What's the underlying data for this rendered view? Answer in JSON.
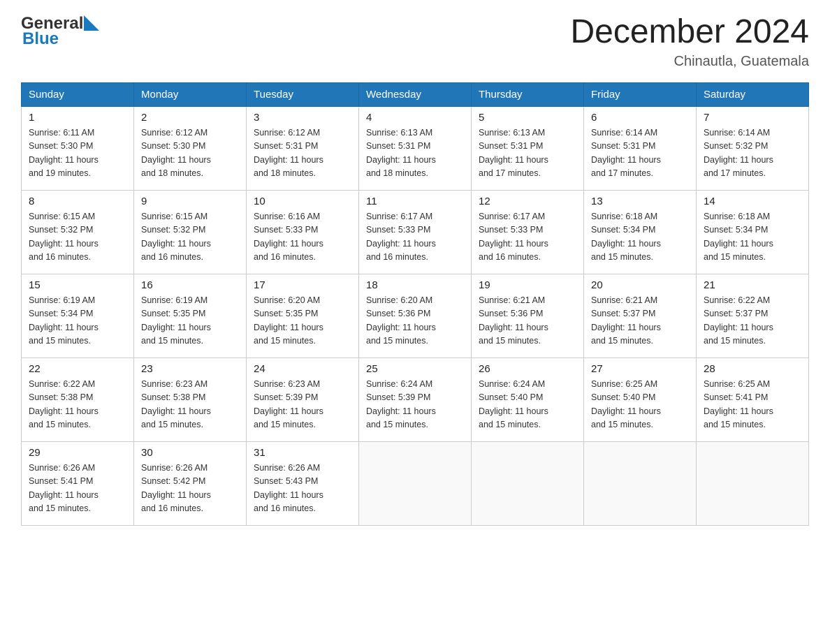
{
  "header": {
    "logo_general": "General",
    "logo_blue": "Blue",
    "month_title": "December 2024",
    "location": "Chinautla, Guatemala"
  },
  "days_of_week": [
    "Sunday",
    "Monday",
    "Tuesday",
    "Wednesday",
    "Thursday",
    "Friday",
    "Saturday"
  ],
  "weeks": [
    [
      {
        "day": "1",
        "sunrise": "6:11 AM",
        "sunset": "5:30 PM",
        "daylight": "11 hours and 19 minutes."
      },
      {
        "day": "2",
        "sunrise": "6:12 AM",
        "sunset": "5:30 PM",
        "daylight": "11 hours and 18 minutes."
      },
      {
        "day": "3",
        "sunrise": "6:12 AM",
        "sunset": "5:31 PM",
        "daylight": "11 hours and 18 minutes."
      },
      {
        "day": "4",
        "sunrise": "6:13 AM",
        "sunset": "5:31 PM",
        "daylight": "11 hours and 18 minutes."
      },
      {
        "day": "5",
        "sunrise": "6:13 AM",
        "sunset": "5:31 PM",
        "daylight": "11 hours and 17 minutes."
      },
      {
        "day": "6",
        "sunrise": "6:14 AM",
        "sunset": "5:31 PM",
        "daylight": "11 hours and 17 minutes."
      },
      {
        "day": "7",
        "sunrise": "6:14 AM",
        "sunset": "5:32 PM",
        "daylight": "11 hours and 17 minutes."
      }
    ],
    [
      {
        "day": "8",
        "sunrise": "6:15 AM",
        "sunset": "5:32 PM",
        "daylight": "11 hours and 16 minutes."
      },
      {
        "day": "9",
        "sunrise": "6:15 AM",
        "sunset": "5:32 PM",
        "daylight": "11 hours and 16 minutes."
      },
      {
        "day": "10",
        "sunrise": "6:16 AM",
        "sunset": "5:33 PM",
        "daylight": "11 hours and 16 minutes."
      },
      {
        "day": "11",
        "sunrise": "6:17 AM",
        "sunset": "5:33 PM",
        "daylight": "11 hours and 16 minutes."
      },
      {
        "day": "12",
        "sunrise": "6:17 AM",
        "sunset": "5:33 PM",
        "daylight": "11 hours and 16 minutes."
      },
      {
        "day": "13",
        "sunrise": "6:18 AM",
        "sunset": "5:34 PM",
        "daylight": "11 hours and 15 minutes."
      },
      {
        "day": "14",
        "sunrise": "6:18 AM",
        "sunset": "5:34 PM",
        "daylight": "11 hours and 15 minutes."
      }
    ],
    [
      {
        "day": "15",
        "sunrise": "6:19 AM",
        "sunset": "5:34 PM",
        "daylight": "11 hours and 15 minutes."
      },
      {
        "day": "16",
        "sunrise": "6:19 AM",
        "sunset": "5:35 PM",
        "daylight": "11 hours and 15 minutes."
      },
      {
        "day": "17",
        "sunrise": "6:20 AM",
        "sunset": "5:35 PM",
        "daylight": "11 hours and 15 minutes."
      },
      {
        "day": "18",
        "sunrise": "6:20 AM",
        "sunset": "5:36 PM",
        "daylight": "11 hours and 15 minutes."
      },
      {
        "day": "19",
        "sunrise": "6:21 AM",
        "sunset": "5:36 PM",
        "daylight": "11 hours and 15 minutes."
      },
      {
        "day": "20",
        "sunrise": "6:21 AM",
        "sunset": "5:37 PM",
        "daylight": "11 hours and 15 minutes."
      },
      {
        "day": "21",
        "sunrise": "6:22 AM",
        "sunset": "5:37 PM",
        "daylight": "11 hours and 15 minutes."
      }
    ],
    [
      {
        "day": "22",
        "sunrise": "6:22 AM",
        "sunset": "5:38 PM",
        "daylight": "11 hours and 15 minutes."
      },
      {
        "day": "23",
        "sunrise": "6:23 AM",
        "sunset": "5:38 PM",
        "daylight": "11 hours and 15 minutes."
      },
      {
        "day": "24",
        "sunrise": "6:23 AM",
        "sunset": "5:39 PM",
        "daylight": "11 hours and 15 minutes."
      },
      {
        "day": "25",
        "sunrise": "6:24 AM",
        "sunset": "5:39 PM",
        "daylight": "11 hours and 15 minutes."
      },
      {
        "day": "26",
        "sunrise": "6:24 AM",
        "sunset": "5:40 PM",
        "daylight": "11 hours and 15 minutes."
      },
      {
        "day": "27",
        "sunrise": "6:25 AM",
        "sunset": "5:40 PM",
        "daylight": "11 hours and 15 minutes."
      },
      {
        "day": "28",
        "sunrise": "6:25 AM",
        "sunset": "5:41 PM",
        "daylight": "11 hours and 15 minutes."
      }
    ],
    [
      {
        "day": "29",
        "sunrise": "6:26 AM",
        "sunset": "5:41 PM",
        "daylight": "11 hours and 15 minutes."
      },
      {
        "day": "30",
        "sunrise": "6:26 AM",
        "sunset": "5:42 PM",
        "daylight": "11 hours and 16 minutes."
      },
      {
        "day": "31",
        "sunrise": "6:26 AM",
        "sunset": "5:43 PM",
        "daylight": "11 hours and 16 minutes."
      },
      null,
      null,
      null,
      null
    ]
  ],
  "labels": {
    "sunrise": "Sunrise:",
    "sunset": "Sunset:",
    "daylight": "Daylight:"
  }
}
